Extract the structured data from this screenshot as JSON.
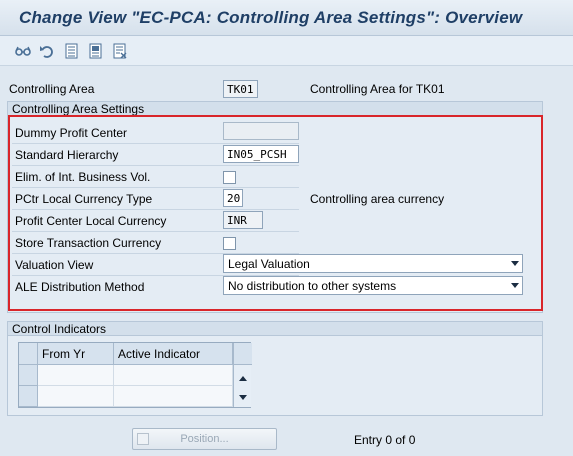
{
  "window": {
    "title": "Change View \"EC-PCA: Controlling Area Settings\": Overview"
  },
  "toolbar": {
    "icons": [
      "glasses-icon",
      "undo-icon",
      "select-all-icon",
      "select-block-icon",
      "deselect-all-icon"
    ]
  },
  "header": {
    "controlling_area_label": "Controlling Area",
    "controlling_area_value": "TK01",
    "controlling_area_desc": "Controlling Area for TK01"
  },
  "settings": {
    "group_title": "Controlling Area Settings",
    "dummy_profit_center_label": "Dummy Profit Center",
    "dummy_profit_center_value": "",
    "standard_hierarchy_label": "Standard Hierarchy",
    "standard_hierarchy_value": "IN05_PCSH",
    "elim_label": "Elim. of Int. Business Vol.",
    "elim_checked": false,
    "pctr_currency_type_label": "PCtr Local Currency Type",
    "pctr_currency_type_value": "20",
    "pctr_currency_type_desc": "Controlling area currency",
    "pc_local_currency_label": "Profit Center Local Currency",
    "pc_local_currency_value": "INR",
    "store_txn_currency_label": "Store Transaction Currency",
    "store_txn_currency_checked": false,
    "valuation_view_label": "Valuation View",
    "valuation_view_value": "Legal Valuation",
    "ale_method_label": "ALE Distribution Method",
    "ale_method_value": "No distribution to other systems"
  },
  "control_indicators": {
    "group_title": "Control Indicators",
    "columns": [
      "From Yr",
      "Active Indicator"
    ],
    "rows": []
  },
  "footer": {
    "position_button_label": "Position...",
    "entry_text": "Entry 0 of 0"
  },
  "colors": {
    "title": "#1f3f66",
    "highlight_border": "#d9252a",
    "background": "#dfe8f1"
  }
}
